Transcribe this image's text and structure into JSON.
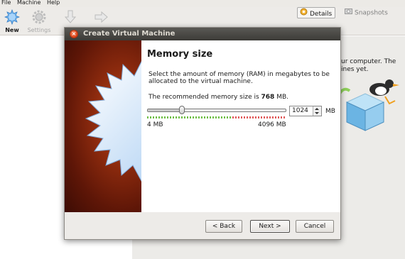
{
  "menubar": {
    "items": [
      "File",
      "Machine",
      "Help"
    ]
  },
  "toolbar": {
    "new_label": "New",
    "settings_label": "Settings",
    "discard_label": "D",
    "details_label": "Details",
    "snapshots_label": "Snapshots"
  },
  "welcome": {
    "line1": "ur computer. The",
    "line2": "ines yet."
  },
  "dialog": {
    "title": "Create Virtual Machine",
    "page_title": "Memory size",
    "description": "Select the amount of memory (RAM) in megabytes to be allocated to the virtual machine.",
    "recommended_prefix": "The recommended memory size is ",
    "recommended_value": "768",
    "recommended_suffix": " MB.",
    "memory_value": "1024",
    "memory_unit": "MB",
    "slider_min_label": "4 MB",
    "slider_max_label": "4096 MB",
    "slider_fraction": 0.25,
    "buttons": {
      "back": "< Back",
      "next": "Next >",
      "cancel": "Cancel"
    }
  },
  "colors": {
    "titlebar": "#3c3b37",
    "close": "#e0431a",
    "side_art": "#8e2b0e"
  }
}
